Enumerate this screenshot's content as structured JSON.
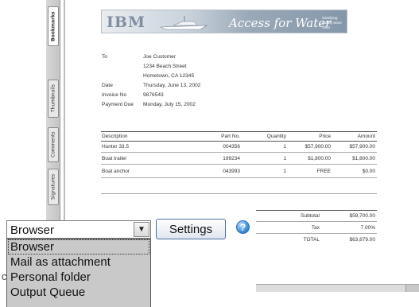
{
  "nav_tabs": [
    {
      "label": "Bookmarks",
      "active": true
    },
    {
      "label": "Thumbnails",
      "active": false
    },
    {
      "label": "Comments",
      "active": false
    },
    {
      "label": "Signatures",
      "active": false
    }
  ],
  "banner": {
    "logo": "IBM",
    "title": "Access for Water",
    "tagline": "Satisfying quality since 1964"
  },
  "address": {
    "to_label": "To",
    "lines": [
      "Joe Customer",
      "1234 Beach Street",
      "Hometown, CA 12345"
    ],
    "date_label": "Date",
    "date": "Thursday, June 13, 2002",
    "invoice_label": "Invoice No",
    "invoice": "9876543",
    "due_label": "Payment Due",
    "due": "Monday, July 15, 2002"
  },
  "table": {
    "headers": [
      "Description",
      "Part No.",
      "Quantity",
      "Price",
      "Amount"
    ],
    "rows": [
      [
        "Hunter 33.5",
        "004356",
        "1",
        "$57,900.00",
        "$57,900.00"
      ],
      [
        "Boat trailer",
        "199234",
        "1",
        "$1,800.00",
        "$1,800.00"
      ],
      [
        "Boat anchor",
        "043993",
        "1",
        "FREE",
        "$0.00"
      ]
    ]
  },
  "totals": {
    "subtotal_label": "Subtotal",
    "subtotal": "$59,700.00",
    "tax_label": "Tax",
    "tax": "7.00%",
    "total_label": "TOTAL",
    "total": "$63,879.00"
  },
  "delivery": {
    "selected": "Browser",
    "options": [
      "Browser",
      "Mail as attachment",
      "Personal folder",
      "Output Queue"
    ],
    "settings_label": "Settings",
    "help": "?"
  },
  "stray_char": "c"
}
